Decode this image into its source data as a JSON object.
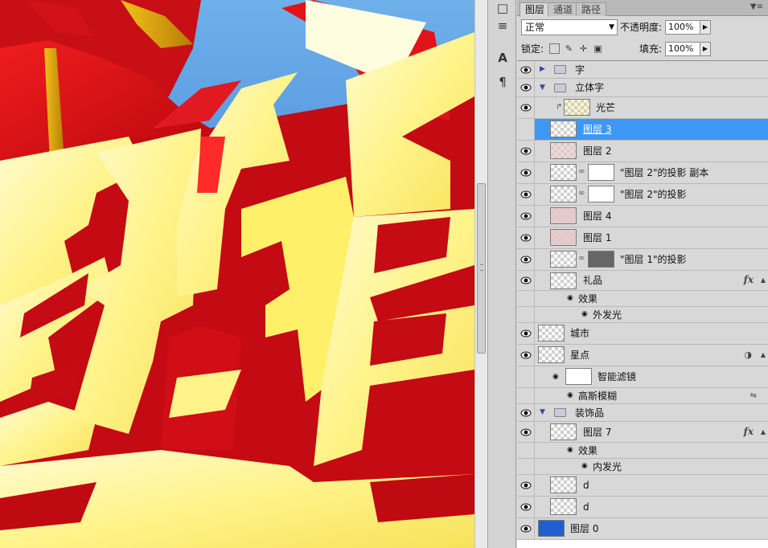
{
  "tools": {
    "tool_icons": [
      "text-icon",
      "paragraph-icon",
      "stamp-icon",
      "brush-presets-icon"
    ]
  },
  "panel": {
    "tabs": [
      {
        "label": "图层",
        "active": true
      },
      {
        "label": "通道",
        "active": false
      },
      {
        "label": "路径",
        "active": false
      }
    ],
    "blend_mode": "正常",
    "opacity_label": "不透明度:",
    "opacity_value": "100%",
    "lock_label": "锁定:",
    "fill_label": "填充:",
    "fill_value": "100%"
  },
  "layers": [
    {
      "name": "字",
      "kind": "group",
      "expanded": false
    },
    {
      "name": "立体字",
      "kind": "group",
      "expanded": true
    },
    {
      "name": "光芒",
      "kind": "layer",
      "clipped": true
    },
    {
      "name": "图层 3",
      "kind": "layer",
      "selected": true
    },
    {
      "name": "图层 2",
      "kind": "layer"
    },
    {
      "name": "\"图层 2\"的投影 副本",
      "kind": "layer",
      "mask": true
    },
    {
      "name": "\"图层 2\"的投影",
      "kind": "layer",
      "mask": true
    },
    {
      "name": "图层 4",
      "kind": "layer"
    },
    {
      "name": "图层 1",
      "kind": "layer"
    },
    {
      "name": "\"图层 1\"的投影",
      "kind": "layer",
      "mask": true
    },
    {
      "name": "礼品",
      "kind": "layer",
      "fx": true
    },
    {
      "name": "效果",
      "kind": "effects-header"
    },
    {
      "name": "外发光",
      "kind": "effect"
    },
    {
      "name": "城市",
      "kind": "layer"
    },
    {
      "name": "星点",
      "kind": "smart-object"
    },
    {
      "name": "智能滤镜",
      "kind": "smart-filter-header"
    },
    {
      "name": "高斯模糊",
      "kind": "filter"
    },
    {
      "name": "装饰品",
      "kind": "group",
      "expanded": true
    },
    {
      "name": "图层 7",
      "kind": "layer",
      "fx": true
    },
    {
      "name": "效果",
      "kind": "effects-header"
    },
    {
      "name": "内发光",
      "kind": "effect"
    },
    {
      "name": "d",
      "kind": "layer"
    },
    {
      "name": "d",
      "kind": "layer"
    },
    {
      "name": "图层 0",
      "kind": "layer"
    }
  ],
  "colors": {
    "selection": "#3d98f5",
    "gift_red": "#e0121a",
    "text_yellow": "#fff27a",
    "sky_blue": "#2f7fd6"
  }
}
